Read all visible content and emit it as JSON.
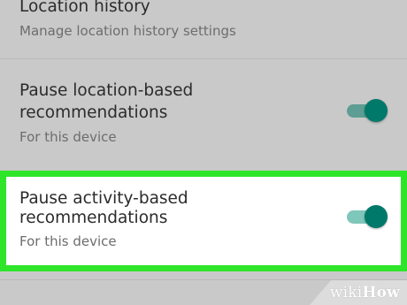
{
  "settings": {
    "location_history": {
      "title": "Location history",
      "subtitle": "Manage location history settings"
    },
    "pause_location": {
      "title_line1": "Pause location-based",
      "title_line2": "recommendations",
      "subtitle": "For this device",
      "enabled": true
    },
    "pause_activity": {
      "title_line1": "Pause activity-based",
      "title_line2": "recommendations",
      "subtitle": "For this device",
      "enabled": true
    }
  },
  "watermark": {
    "prefix": "wiki",
    "suffix": "How"
  },
  "colors": {
    "background": "#c9c9c9",
    "highlight_border": "#2ee52a",
    "toggle_thumb": "#00796b",
    "toggle_track_dim": "#5e9d93",
    "toggle_track_light": "#7fc6bb"
  }
}
